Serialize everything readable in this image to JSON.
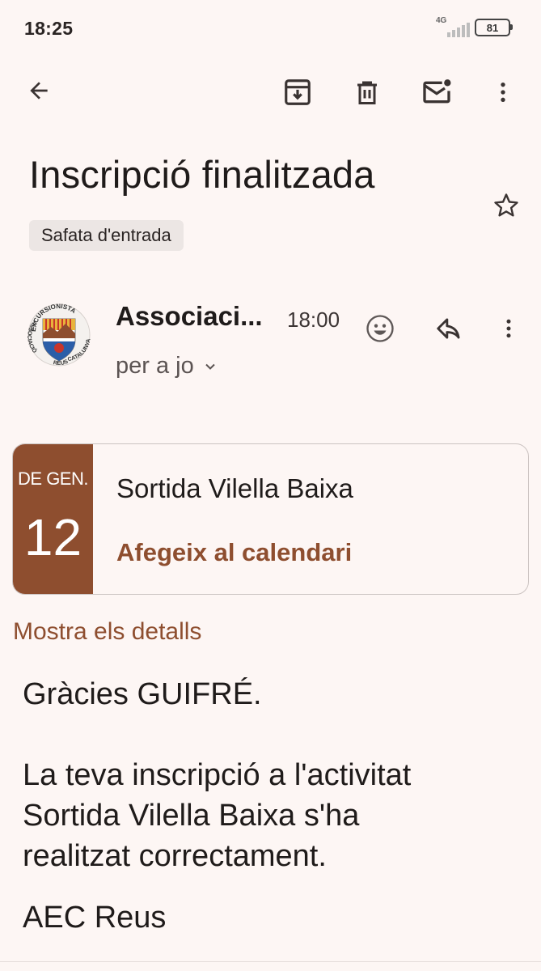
{
  "status_bar": {
    "time": "18:25",
    "network": "4G",
    "battery": "81"
  },
  "toolbar": {
    "back_icon": "arrow-back-icon",
    "archive_icon": "archive-icon",
    "delete_icon": "trash-icon",
    "mark_unread_icon": "mail-unread-icon",
    "more_icon": "more-vert-icon"
  },
  "email": {
    "subject": "Inscripció finalitzada",
    "label": "Safata d'entrada",
    "sender": "Associaci...",
    "time": "18:00",
    "recipient": "per a jo"
  },
  "event": {
    "month": "DE GEN.",
    "day": "12",
    "title": "Sortida Vilella Baixa",
    "add_to_calendar": "Afegeix al calendari"
  },
  "show_details": "Mostra els detalls",
  "body": {
    "greeting": "Gràcies GUIFRÉ.",
    "line1": "La teva inscripció a l'activitat",
    "line2": "Sortida Vilella Baixa s'ha",
    "line3": "realitzat correctament.",
    "signature": "AEC Reus"
  },
  "avatar": {
    "top_text": "EXCURSIONISTA",
    "left_text": "ASSOCIACIÓ",
    "right_text": "CATALUNYA",
    "bottom_text": "REUS"
  },
  "colors": {
    "accent": "#8e4e2f",
    "background": "#fdf6f4"
  }
}
